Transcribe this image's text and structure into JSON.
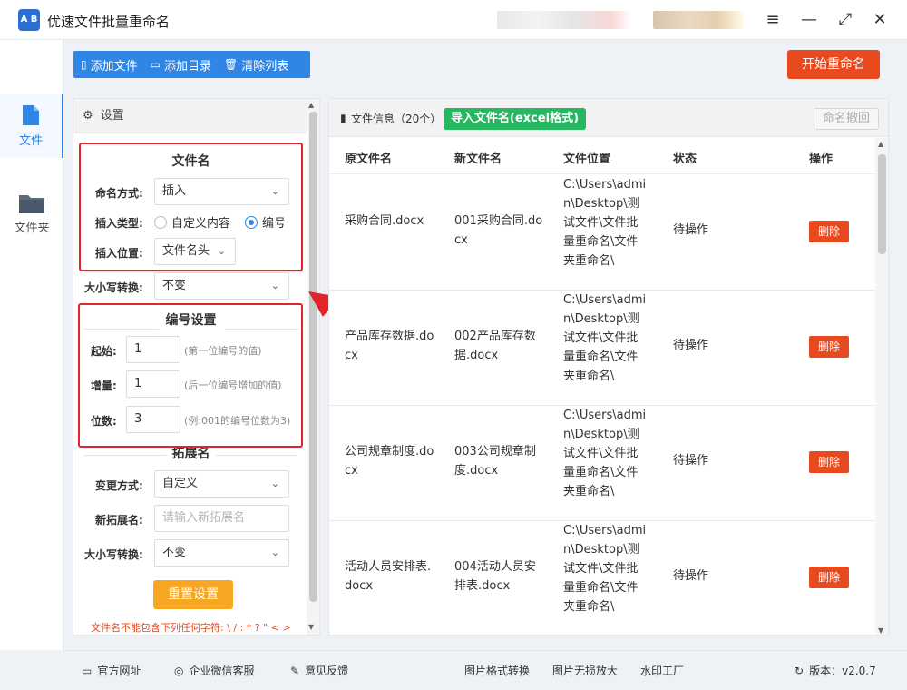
{
  "app": {
    "logo_text": "A B",
    "title": "优速文件批量重命名"
  },
  "window": {
    "menu_glyph": "≡",
    "minimize_glyph": "—",
    "maximize_glyph": "⤢",
    "close_glyph": "✕"
  },
  "nav": {
    "items": [
      {
        "label": "文件",
        "icon": "file-icon",
        "active": true
      },
      {
        "label": "文件夹",
        "icon": "folder-icon",
        "active": false
      }
    ]
  },
  "toolbar": {
    "add_file": "添加文件",
    "add_dir": "添加目录",
    "clear_list": "清除列表",
    "start": "开始重命名"
  },
  "settings": {
    "header": "设置",
    "filename_section": "文件名",
    "naming_mode_label": "命名方式:",
    "naming_mode_value": "插入",
    "insert_type_label": "插入类型:",
    "insert_type_options": [
      "自定义内容",
      "编号"
    ],
    "insert_type_selected": "编号",
    "insert_pos_label": "插入位置:",
    "insert_pos_value": "文件名头",
    "case_label": "大小写转换:",
    "case_value": "不变",
    "numbering_section": "编号设置",
    "start_label": "起始:",
    "start_value": "1",
    "start_hint": "(第一位编号的值)",
    "step_label": "增量:",
    "step_value": "1",
    "step_hint": "(后一位编号增加的值)",
    "digits_label": "位数:",
    "digits_value": "3",
    "digits_hint": "(例:001的编号位数为3)",
    "ext_section": "拓展名",
    "ext_mode_label": "变更方式:",
    "ext_mode_value": "自定义",
    "new_ext_label": "新拓展名:",
    "new_ext_placeholder": "请输入新拓展名",
    "ext_case_label": "大小写转换:",
    "ext_case_value": "不变",
    "reset_button": "重置设置",
    "warning": "文件名不能包含下列任何字符: \\ / : * ? \" < >"
  },
  "files": {
    "title": "文件信息（20个）",
    "import_button": "导入文件名(excel格式)",
    "undo_button": "命名撤回",
    "columns": [
      "原文件名",
      "新文件名",
      "文件位置",
      "状态",
      "操作"
    ],
    "rows": [
      {
        "orig": "采购合同.docx",
        "new": "001采购合同.docx",
        "loc": "C:\\Users\\admin\\Desktop\\测试文件\\文件批量重命名\\文件夹重命名\\",
        "status": "待操作",
        "action": "删除"
      },
      {
        "orig": "产品库存数据.docx",
        "new": "002产品库存数据.docx",
        "loc": "C:\\Users\\admin\\Desktop\\测试文件\\文件批量重命名\\文件夹重命名\\",
        "status": "待操作",
        "action": "删除"
      },
      {
        "orig": "公司规章制度.docx",
        "new": "003公司规章制度.docx",
        "loc": "C:\\Users\\admin\\Desktop\\测试文件\\文件批量重命名\\文件夹重命名\\",
        "status": "待操作",
        "action": "删除"
      },
      {
        "orig": "活动人员安排表.docx",
        "new": "004活动人员安排表.docx",
        "loc": "C:\\Users\\admin\\Desktop\\测试文件\\文件批量重命名\\文件夹重命名\\",
        "status": "待操作",
        "action": "删除"
      }
    ]
  },
  "footer": {
    "website": "官方网址",
    "wechat": "企业微信客服",
    "feedback": "意见反馈",
    "img_convert": "图片格式转换",
    "img_enlarge": "图片无损放大",
    "watermark": "水印工厂",
    "version": "版本：v2.0.7"
  },
  "colors": {
    "primary": "#2f86e5",
    "start": "#e84a1f",
    "import": "#27b760",
    "reset": "#f6a623",
    "highlight": "#e0262a"
  }
}
